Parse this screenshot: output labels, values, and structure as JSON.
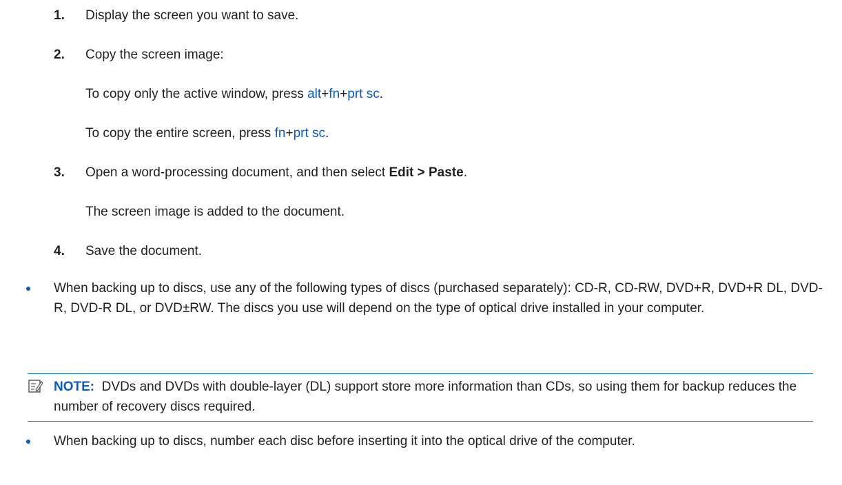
{
  "steps": [
    {
      "num": "1.",
      "text": "Display the screen you want to save."
    },
    {
      "num": "2.",
      "text": "Copy the screen image:"
    },
    {
      "num": "3.",
      "text_pre": "Open a word-processing document, and then select ",
      "text_bold": "Edit > Paste",
      "text_post": "."
    },
    {
      "num": "4.",
      "text": "Save the document."
    }
  ],
  "copy_active": {
    "pre": "To copy only the active window, press ",
    "k1": "alt",
    "p1": "+",
    "k2": "fn",
    "p2": "+",
    "k3": "prt sc",
    "post": "."
  },
  "copy_entire": {
    "pre": "To copy the entire screen, press ",
    "k1": "fn",
    "p1": "+",
    "k2": "prt sc",
    "post": "."
  },
  "added": "The screen image is added to the document.",
  "bullet1": "When backing up to discs, use any of the following types of discs (purchased separately): CD-R, CD-RW, DVD+R, DVD+R DL, DVD-R, DVD-R DL, or DVD±RW. The discs you use will depend on the type of optical drive installed in your computer.",
  "note": {
    "label": "NOTE:",
    "text": "DVDs and DVDs with double-layer (DL) support store more information than CDs, so using them for backup reduces the number of recovery discs required."
  },
  "bullet2": "When backing up to discs, number each disc before inserting it into the optical drive of the computer.",
  "colors": {
    "accent": "#0a5bc4",
    "text": "#231f20"
  }
}
